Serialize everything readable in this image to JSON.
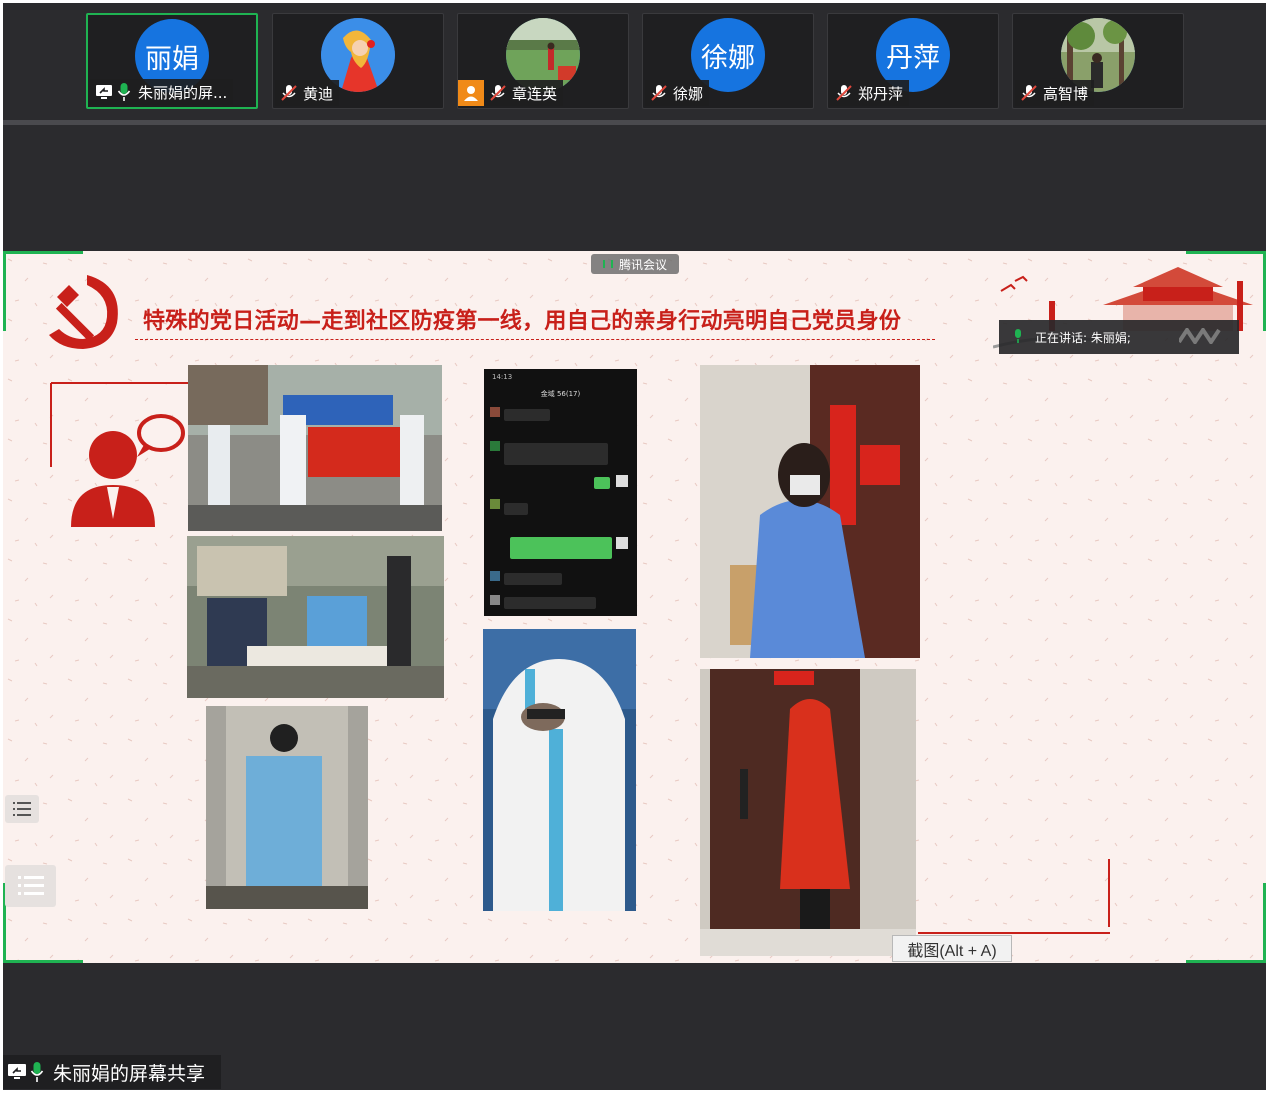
{
  "participants": [
    {
      "name": "朱丽娟的屏...",
      "avatar_text": "丽娟",
      "avatar_type": "text",
      "mic": "on",
      "sharing": true,
      "active": true
    },
    {
      "name": "黄迪",
      "avatar_text": "",
      "avatar_type": "photo-portrait",
      "mic": "muted"
    },
    {
      "name": "章连英",
      "avatar_text": "",
      "avatar_type": "photo-field",
      "mic": "muted",
      "badge": "person-icon"
    },
    {
      "name": "徐娜",
      "avatar_text": "徐娜",
      "avatar_type": "text",
      "mic": "muted"
    },
    {
      "name": "郑丹萍",
      "avatar_text": "丹萍",
      "avatar_type": "text",
      "mic": "muted"
    },
    {
      "name": "高智博",
      "avatar_text": "",
      "avatar_type": "photo-tree",
      "mic": "muted"
    }
  ],
  "shared_screen": {
    "meeting_tag": "腾讯会议",
    "slide_title": "特殊的党日活动—走到社区防疫第一线，用自己的亲身行动亮明自己党员身份",
    "speaking_label": "正在讲话: 朱丽娟;",
    "screenshot_tip": "截图(Alt + A)",
    "chat_header": "金域 56(17)",
    "chat_time": "14:13"
  },
  "share_indicator": {
    "label": "朱丽娟的屏幕共享"
  },
  "colors": {
    "accent_green": "#1fb352",
    "avatar_blue": "#1674e0",
    "party_red": "#c8201a",
    "dark_bg": "#2b2b2e"
  }
}
